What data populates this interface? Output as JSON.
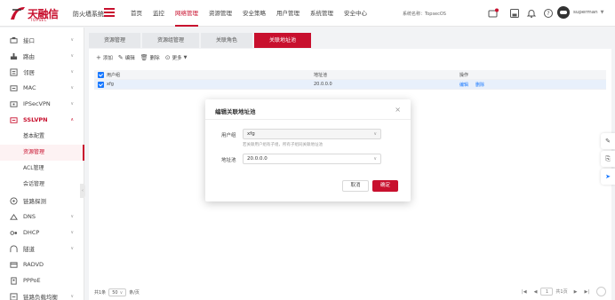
{
  "header": {
    "logo_text": "天融信",
    "logo_sub": "TOPSEC",
    "product_name": "防火墙系统",
    "nav": [
      "首页",
      "监控",
      "网络管理",
      "资源管理",
      "安全策略",
      "用户管理",
      "系统管理",
      "安全中心"
    ],
    "active_nav": "网络管理",
    "system_name": "系统名称：TopsecOS",
    "user_name": "superman",
    "user_caret": "▼",
    "accent": "#c8102e"
  },
  "sidebar": {
    "items": [
      {
        "label": "接口",
        "icon": "interface-icon",
        "arrow": "∨"
      },
      {
        "label": "路由",
        "icon": "route-icon",
        "arrow": "∨"
      },
      {
        "label": "邻居",
        "icon": "neighbor-icon",
        "arrow": "∨"
      },
      {
        "label": "MAC",
        "icon": "mac-icon",
        "arrow": "∨"
      },
      {
        "label": "IPSecVPN",
        "icon": "ipsec-icon",
        "arrow": "∨"
      },
      {
        "label": "SSLVPN",
        "icon": "sslvpn-icon",
        "arrow": "∧"
      }
    ],
    "sub_items": [
      "基本配置",
      "资源管理",
      "ACL管理",
      "会话管理"
    ],
    "active_sub": "资源管理",
    "items_after": [
      {
        "label": "链路探测",
        "icon": "probe-icon",
        "arrow": ""
      },
      {
        "label": "DNS",
        "icon": "dns-icon",
        "arrow": "∨"
      },
      {
        "label": "DHCP",
        "icon": "dhcp-icon",
        "arrow": "∨"
      },
      {
        "label": "隧道",
        "icon": "tunnel-icon",
        "arrow": "∨"
      },
      {
        "label": "RADVD",
        "icon": "radvd-icon",
        "arrow": ""
      },
      {
        "label": "PPPoE",
        "icon": "pppoe-icon",
        "arrow": ""
      },
      {
        "label": "链路负载均衡",
        "icon": "lb-icon",
        "arrow": "∨"
      }
    ]
  },
  "tabs": [
    "资源管理",
    "资源组管理",
    "关联角色",
    "关联地址池"
  ],
  "active_tab": "关联地址池",
  "toolbar": {
    "add": "添加",
    "edit": "编辑",
    "delete": "删除",
    "more": "更多"
  },
  "table": {
    "columns": [
      "用户组",
      "地址池",
      "操作"
    ],
    "rows": [
      {
        "group": "xfg",
        "pool": "20.0.0.0",
        "edit": "编辑",
        "delete": "删除"
      }
    ]
  },
  "pager": {
    "total": "共1条",
    "page_size": "50",
    "per_page_suffix": "条/页",
    "page": "1",
    "total_pages": "共1页"
  },
  "modal": {
    "title": "编辑关联地址池",
    "group_label": "用户组",
    "group_value": "xfg",
    "hint": "若关联用户组有子组，所有子组同关联地址池",
    "pool_label": "地址池",
    "pool_value": "20.0.0.0",
    "cancel": "取消",
    "ok": "确定"
  }
}
